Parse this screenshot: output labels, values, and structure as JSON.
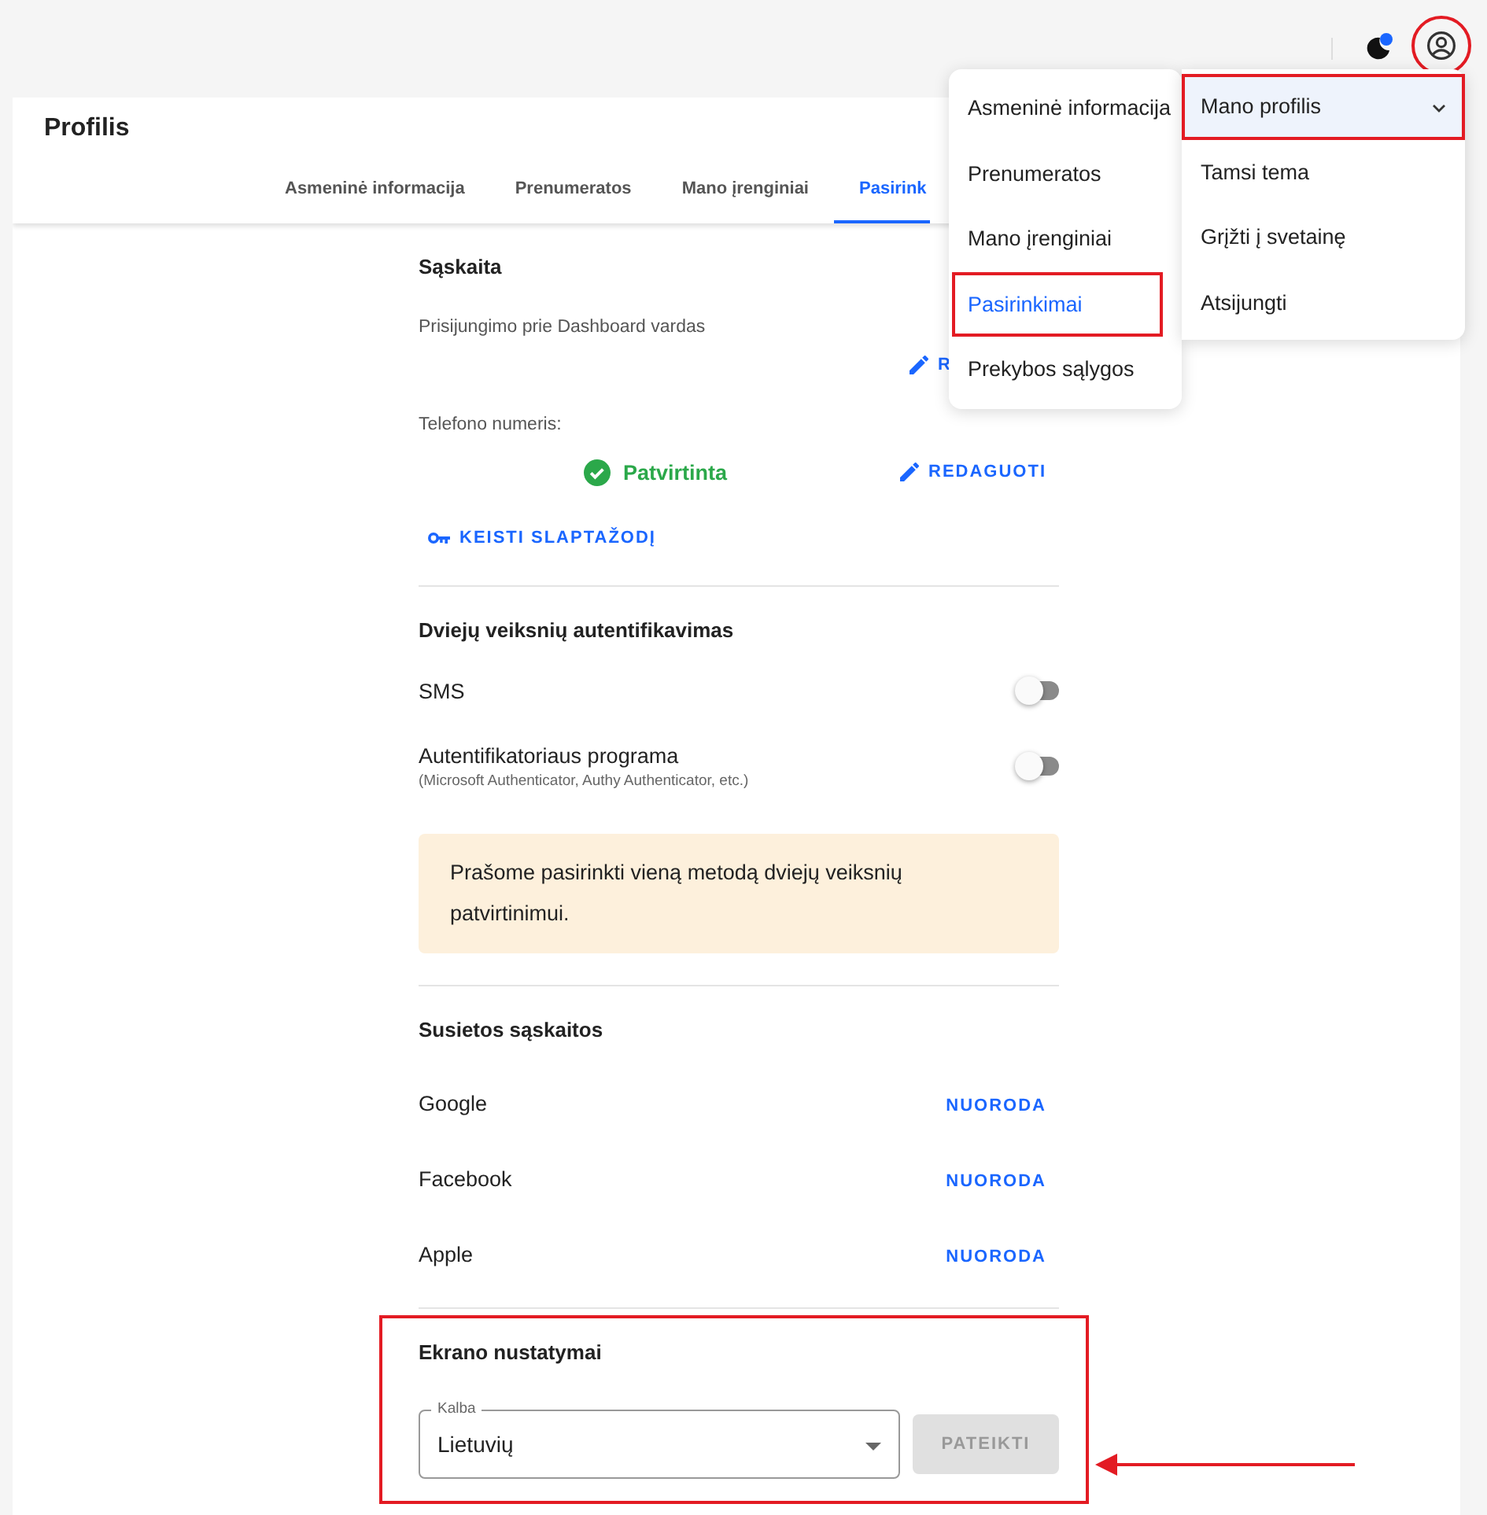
{
  "top_bar": {
    "notification_dot": true,
    "account_annotated": true
  },
  "page": {
    "title": "Profilis"
  },
  "tabs": [
    {
      "label": "Asmeninė informacija",
      "selected": false
    },
    {
      "label": "Prenumeratos",
      "selected": false
    },
    {
      "label": "Mano įrenginiai",
      "selected": false
    },
    {
      "label": "Pasirink",
      "selected": true
    }
  ],
  "account": {
    "heading": "Sąskaita",
    "login_label": "Prisijungimo prie Dashboard vardas",
    "login_edit": "R",
    "phone_label": "Telefono numeris:",
    "phone_status": "Patvirtinta",
    "phone_edit": "REDAGUOTI",
    "change_password": "KEISTI SLAPTAŽODĮ"
  },
  "two_factor": {
    "heading": "Dviejų veiksnių autentifikavimas",
    "options": [
      {
        "label": "SMS",
        "on": false
      },
      {
        "label": "Autentifikatoriaus programa",
        "note": "(Microsoft Authenticator, Authy Authenticator, etc.)",
        "on": false
      }
    ],
    "notice": "Prašome pasirinkti vieną metodą dviejų veiksnių patvirtinimui."
  },
  "linked_accounts": {
    "heading": "Susietos sąskaitos",
    "items": [
      {
        "name": "Google",
        "action": "NUORODA"
      },
      {
        "name": "Facebook",
        "action": "NUORODA"
      },
      {
        "name": "Apple",
        "action": "NUORODA"
      }
    ]
  },
  "display_settings": {
    "heading": "Ekrano nustatymai",
    "annotated": true,
    "language": {
      "label": "Kalba",
      "value": "Lietuvių"
    },
    "submit": {
      "label": "PATEIKTI",
      "disabled": true
    }
  },
  "submenu": {
    "items": [
      {
        "label": "Asmeninė informacija",
        "selected": false,
        "annotated": false
      },
      {
        "label": "Prenumeratos",
        "selected": false,
        "annotated": false
      },
      {
        "label": "Mano įrenginiai",
        "selected": false,
        "annotated": false
      },
      {
        "label": "Pasirinkimai",
        "selected": true,
        "annotated": true
      },
      {
        "label": "Prekybos sąlygos",
        "selected": false,
        "annotated": false
      }
    ]
  },
  "profile_menu": {
    "items": [
      {
        "label": "Mano profilis",
        "selected": true,
        "has_submenu": true,
        "annotated": true
      },
      {
        "label": "Tamsi tema",
        "selected": false,
        "has_submenu": false,
        "annotated": false
      },
      {
        "label": "Grįžti į svetainę",
        "selected": false,
        "has_submenu": false,
        "annotated": false
      },
      {
        "label": "Atsijungti",
        "selected": false,
        "has_submenu": false,
        "annotated": false
      }
    ]
  }
}
